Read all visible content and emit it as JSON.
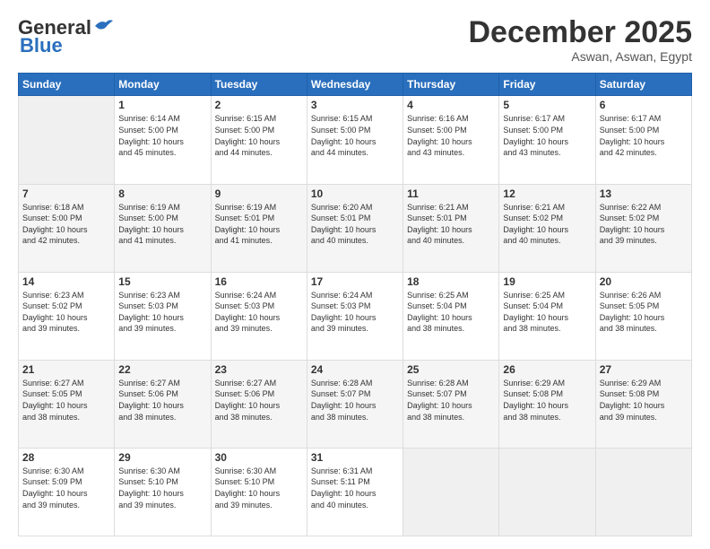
{
  "logo": {
    "general": "General",
    "blue": "Blue"
  },
  "title": "December 2025",
  "subtitle": "Aswan, Aswan, Egypt",
  "days_header": [
    "Sunday",
    "Monday",
    "Tuesday",
    "Wednesday",
    "Thursday",
    "Friday",
    "Saturday"
  ],
  "weeks": [
    [
      {
        "day": "",
        "info": ""
      },
      {
        "day": "1",
        "info": "Sunrise: 6:14 AM\nSunset: 5:00 PM\nDaylight: 10 hours\nand 45 minutes."
      },
      {
        "day": "2",
        "info": "Sunrise: 6:15 AM\nSunset: 5:00 PM\nDaylight: 10 hours\nand 44 minutes."
      },
      {
        "day": "3",
        "info": "Sunrise: 6:15 AM\nSunset: 5:00 PM\nDaylight: 10 hours\nand 44 minutes."
      },
      {
        "day": "4",
        "info": "Sunrise: 6:16 AM\nSunset: 5:00 PM\nDaylight: 10 hours\nand 43 minutes."
      },
      {
        "day": "5",
        "info": "Sunrise: 6:17 AM\nSunset: 5:00 PM\nDaylight: 10 hours\nand 43 minutes."
      },
      {
        "day": "6",
        "info": "Sunrise: 6:17 AM\nSunset: 5:00 PM\nDaylight: 10 hours\nand 42 minutes."
      }
    ],
    [
      {
        "day": "7",
        "info": "Sunrise: 6:18 AM\nSunset: 5:00 PM\nDaylight: 10 hours\nand 42 minutes."
      },
      {
        "day": "8",
        "info": "Sunrise: 6:19 AM\nSunset: 5:00 PM\nDaylight: 10 hours\nand 41 minutes."
      },
      {
        "day": "9",
        "info": "Sunrise: 6:19 AM\nSunset: 5:01 PM\nDaylight: 10 hours\nand 41 minutes."
      },
      {
        "day": "10",
        "info": "Sunrise: 6:20 AM\nSunset: 5:01 PM\nDaylight: 10 hours\nand 40 minutes."
      },
      {
        "day": "11",
        "info": "Sunrise: 6:21 AM\nSunset: 5:01 PM\nDaylight: 10 hours\nand 40 minutes."
      },
      {
        "day": "12",
        "info": "Sunrise: 6:21 AM\nSunset: 5:02 PM\nDaylight: 10 hours\nand 40 minutes."
      },
      {
        "day": "13",
        "info": "Sunrise: 6:22 AM\nSunset: 5:02 PM\nDaylight: 10 hours\nand 39 minutes."
      }
    ],
    [
      {
        "day": "14",
        "info": "Sunrise: 6:23 AM\nSunset: 5:02 PM\nDaylight: 10 hours\nand 39 minutes."
      },
      {
        "day": "15",
        "info": "Sunrise: 6:23 AM\nSunset: 5:03 PM\nDaylight: 10 hours\nand 39 minutes."
      },
      {
        "day": "16",
        "info": "Sunrise: 6:24 AM\nSunset: 5:03 PM\nDaylight: 10 hours\nand 39 minutes."
      },
      {
        "day": "17",
        "info": "Sunrise: 6:24 AM\nSunset: 5:03 PM\nDaylight: 10 hours\nand 39 minutes."
      },
      {
        "day": "18",
        "info": "Sunrise: 6:25 AM\nSunset: 5:04 PM\nDaylight: 10 hours\nand 38 minutes."
      },
      {
        "day": "19",
        "info": "Sunrise: 6:25 AM\nSunset: 5:04 PM\nDaylight: 10 hours\nand 38 minutes."
      },
      {
        "day": "20",
        "info": "Sunrise: 6:26 AM\nSunset: 5:05 PM\nDaylight: 10 hours\nand 38 minutes."
      }
    ],
    [
      {
        "day": "21",
        "info": "Sunrise: 6:27 AM\nSunset: 5:05 PM\nDaylight: 10 hours\nand 38 minutes."
      },
      {
        "day": "22",
        "info": "Sunrise: 6:27 AM\nSunset: 5:06 PM\nDaylight: 10 hours\nand 38 minutes."
      },
      {
        "day": "23",
        "info": "Sunrise: 6:27 AM\nSunset: 5:06 PM\nDaylight: 10 hours\nand 38 minutes."
      },
      {
        "day": "24",
        "info": "Sunrise: 6:28 AM\nSunset: 5:07 PM\nDaylight: 10 hours\nand 38 minutes."
      },
      {
        "day": "25",
        "info": "Sunrise: 6:28 AM\nSunset: 5:07 PM\nDaylight: 10 hours\nand 38 minutes."
      },
      {
        "day": "26",
        "info": "Sunrise: 6:29 AM\nSunset: 5:08 PM\nDaylight: 10 hours\nand 38 minutes."
      },
      {
        "day": "27",
        "info": "Sunrise: 6:29 AM\nSunset: 5:08 PM\nDaylight: 10 hours\nand 39 minutes."
      }
    ],
    [
      {
        "day": "28",
        "info": "Sunrise: 6:30 AM\nSunset: 5:09 PM\nDaylight: 10 hours\nand 39 minutes."
      },
      {
        "day": "29",
        "info": "Sunrise: 6:30 AM\nSunset: 5:10 PM\nDaylight: 10 hours\nand 39 minutes."
      },
      {
        "day": "30",
        "info": "Sunrise: 6:30 AM\nSunset: 5:10 PM\nDaylight: 10 hours\nand 39 minutes."
      },
      {
        "day": "31",
        "info": "Sunrise: 6:31 AM\nSunset: 5:11 PM\nDaylight: 10 hours\nand 40 minutes."
      },
      {
        "day": "",
        "info": ""
      },
      {
        "day": "",
        "info": ""
      },
      {
        "day": "",
        "info": ""
      }
    ]
  ]
}
